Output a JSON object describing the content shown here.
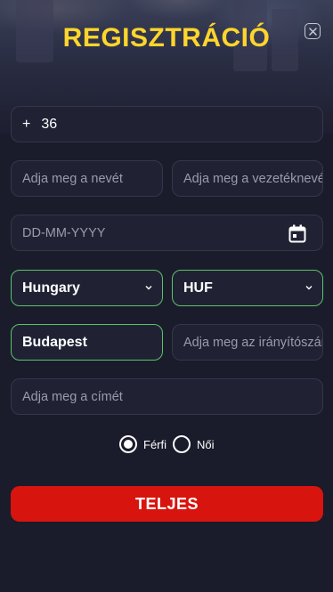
{
  "modal": {
    "title": "REGISZTRÁCIÓ"
  },
  "phone": {
    "prefix": "+",
    "value": "36"
  },
  "first_name": {
    "placeholder": "Adja meg a nevét"
  },
  "last_name": {
    "placeholder": "Adja meg a vezetéknevét"
  },
  "birth_date": {
    "placeholder": "DD-MM-YYYY"
  },
  "country": {
    "value": "Hungary"
  },
  "currency": {
    "value": "HUF"
  },
  "city": {
    "value": "Budapest"
  },
  "postal_code": {
    "placeholder": "Adja meg az irányítószámot"
  },
  "address": {
    "placeholder": "Adja meg a címét"
  },
  "gender": {
    "options": [
      {
        "label": "Férfi",
        "selected": true
      },
      {
        "label": "Női",
        "selected": false
      }
    ]
  },
  "submit": {
    "label": "TELJES"
  },
  "colors": {
    "accent_title": "#ffd52c",
    "submit_bg": "#d8140e",
    "valid_border": "#5ac36a",
    "background": "#1a1b2b"
  },
  "icons": {
    "close": "close-icon",
    "calendar": "calendar-icon",
    "chevron": "chevron-down-icon"
  }
}
